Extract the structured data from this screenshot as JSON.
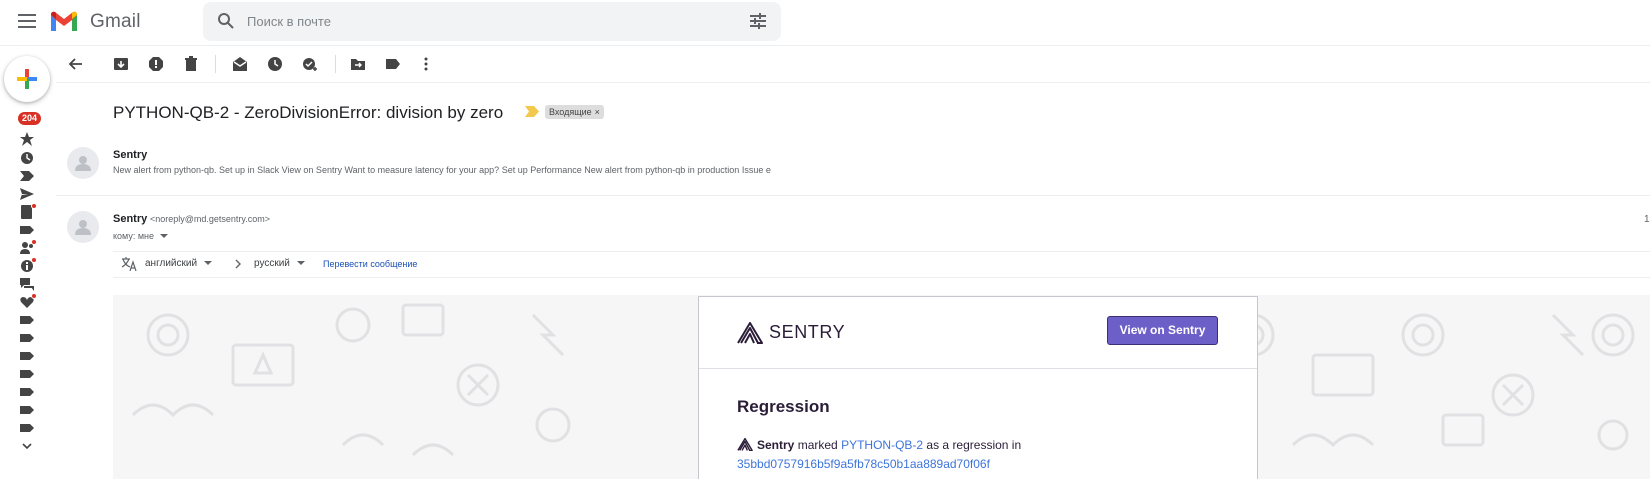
{
  "app": {
    "name": "Gmail"
  },
  "search": {
    "placeholder": "Поиск в почте"
  },
  "left_rail": {
    "unread_count": "204"
  },
  "message": {
    "subject": "PYTHON-QB-2 - ZeroDivisionError: division by zero",
    "label": "Входящие",
    "label_close": "×",
    "collapsed": {
      "sender": "Sentry",
      "snippet": "New alert from python-qb. Set up in Slack View on Sentry Want to measure latency for your app? Set up Performance New alert from python-qb in production Issue e"
    },
    "expanded": {
      "sender": "Sentry",
      "email": "<noreply@md.getsentry.com>",
      "recipients": "кому: мне",
      "right_edge_text": "1"
    }
  },
  "translate": {
    "source_lang": "английский",
    "target_lang": "русский",
    "action": "Перевести сообщение"
  },
  "email_body": {
    "brand": "SENTRY",
    "view_button": "View on Sentry",
    "title": "Regression",
    "actor": "Sentry",
    "text_marked": "marked",
    "issue_link": "PYTHON-QB-2",
    "text_regression": "as a regression in",
    "commit": "35bbd0757916b5f9a5fb78c50b1aa889ad70f06f"
  },
  "colors": {
    "sentry_purple": "#6c5fc7",
    "badge_red": "#d93025",
    "link_blue": "#3d74db"
  }
}
